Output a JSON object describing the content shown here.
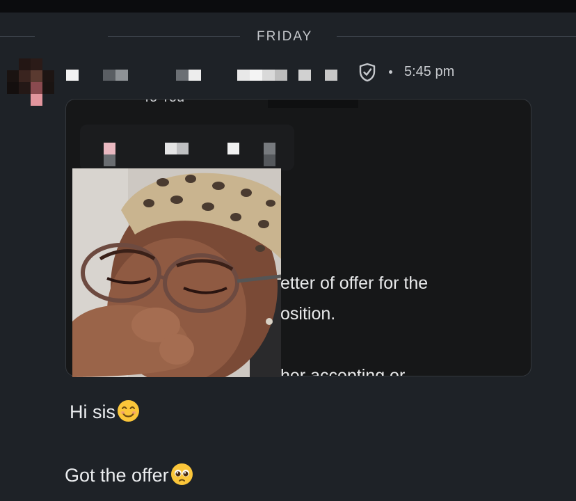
{
  "separator": {
    "day_label": "FRIDAY"
  },
  "message": {
    "timestamp": "5:45 pm",
    "shield_icon": "shield-check-icon",
    "attachment": {
      "top_fragment": "To You",
      "line1": "etter of offer for the",
      "line2": "osition.",
      "line3": "her accepting or"
    },
    "texts": [
      {
        "text": "Hi sis",
        "emoji": "smiling-face-emoji"
      },
      {
        "text": "Got the offer",
        "emoji": "pleading-face-emoji"
      }
    ]
  },
  "colors": {
    "background": "#1e2227",
    "attachment_bg": "#161718",
    "text": "#eceef0",
    "muted": "#c6c9cd"
  }
}
